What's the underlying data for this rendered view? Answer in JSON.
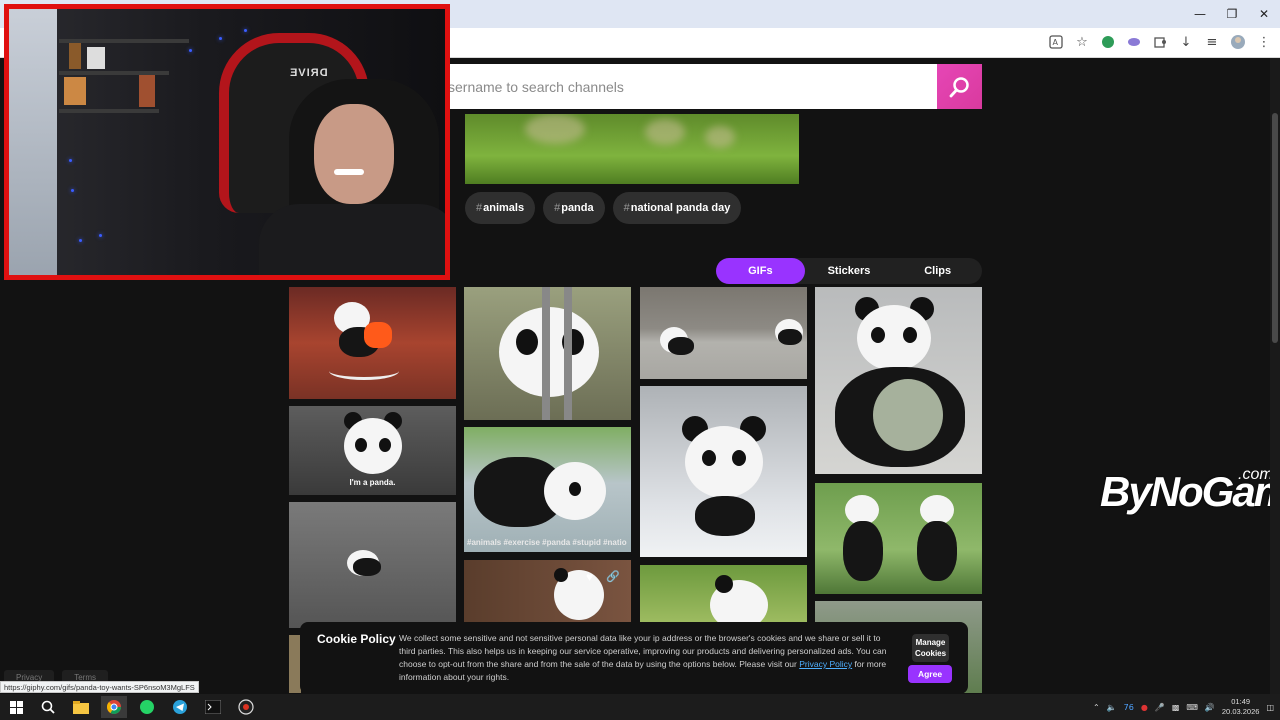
{
  "browser": {
    "window_controls": [
      "minimize",
      "restore",
      "close"
    ],
    "toolbar_icons": [
      "translate-icon",
      "star-icon",
      "extension-icon",
      "extension-2-icon",
      "puzzle-icon",
      "download-icon",
      "reading-list-icon",
      "profile-icon",
      "menu-icon"
    ]
  },
  "search": {
    "placeholder": "sername to search channels"
  },
  "tags": [
    "animals",
    "panda",
    "national panda day"
  ],
  "tabs": [
    "GIFs",
    "Stickers",
    "Clips"
  ],
  "active_tab": "GIFs",
  "tiles": {
    "im_a_panda_caption": "I'm a panda.",
    "hashtags_caption": "#animals #exercise #panda #stupid #natio"
  },
  "watermark": {
    "main": "ByNoGame",
    "suffix": ".com"
  },
  "webcam": {
    "chair_text": "DRIVE"
  },
  "cookie": {
    "title": "Cookie Policy",
    "text_before_link": "We collect some sensitive and not sensitive personal data like your ip address or the browser's cookies and we share or sell it to third parties. This also helps us in keeping our service operative, improving our products and delivering personalized ads. You can choose to opt-out from the share and from the sale of the data by using the options below. Please visit our ",
    "link": "Privacy Policy",
    "text_after_link": " for more information about your rights.",
    "manage_label": "Manage Cookies",
    "agree_label": "Agree"
  },
  "footer": {
    "privacy": "Privacy",
    "terms": "Terms"
  },
  "status_url": "https://giphy.com/gifs/panda-toy-wants-SP6nsoM3MgLFS",
  "taskbar": {
    "apps": [
      "start-icon",
      "search-icon",
      "file-explorer-icon",
      "chrome-icon",
      "whatsapp-icon",
      "telegram-icon",
      "terminal-icon",
      "obs-icon"
    ],
    "tray_number": "76",
    "time": "01:49",
    "date": "20.03.2026"
  },
  "colors": {
    "accent_purple": "#9933ff",
    "search_pink": "#e646b6",
    "webcam_border": "#e01010"
  }
}
